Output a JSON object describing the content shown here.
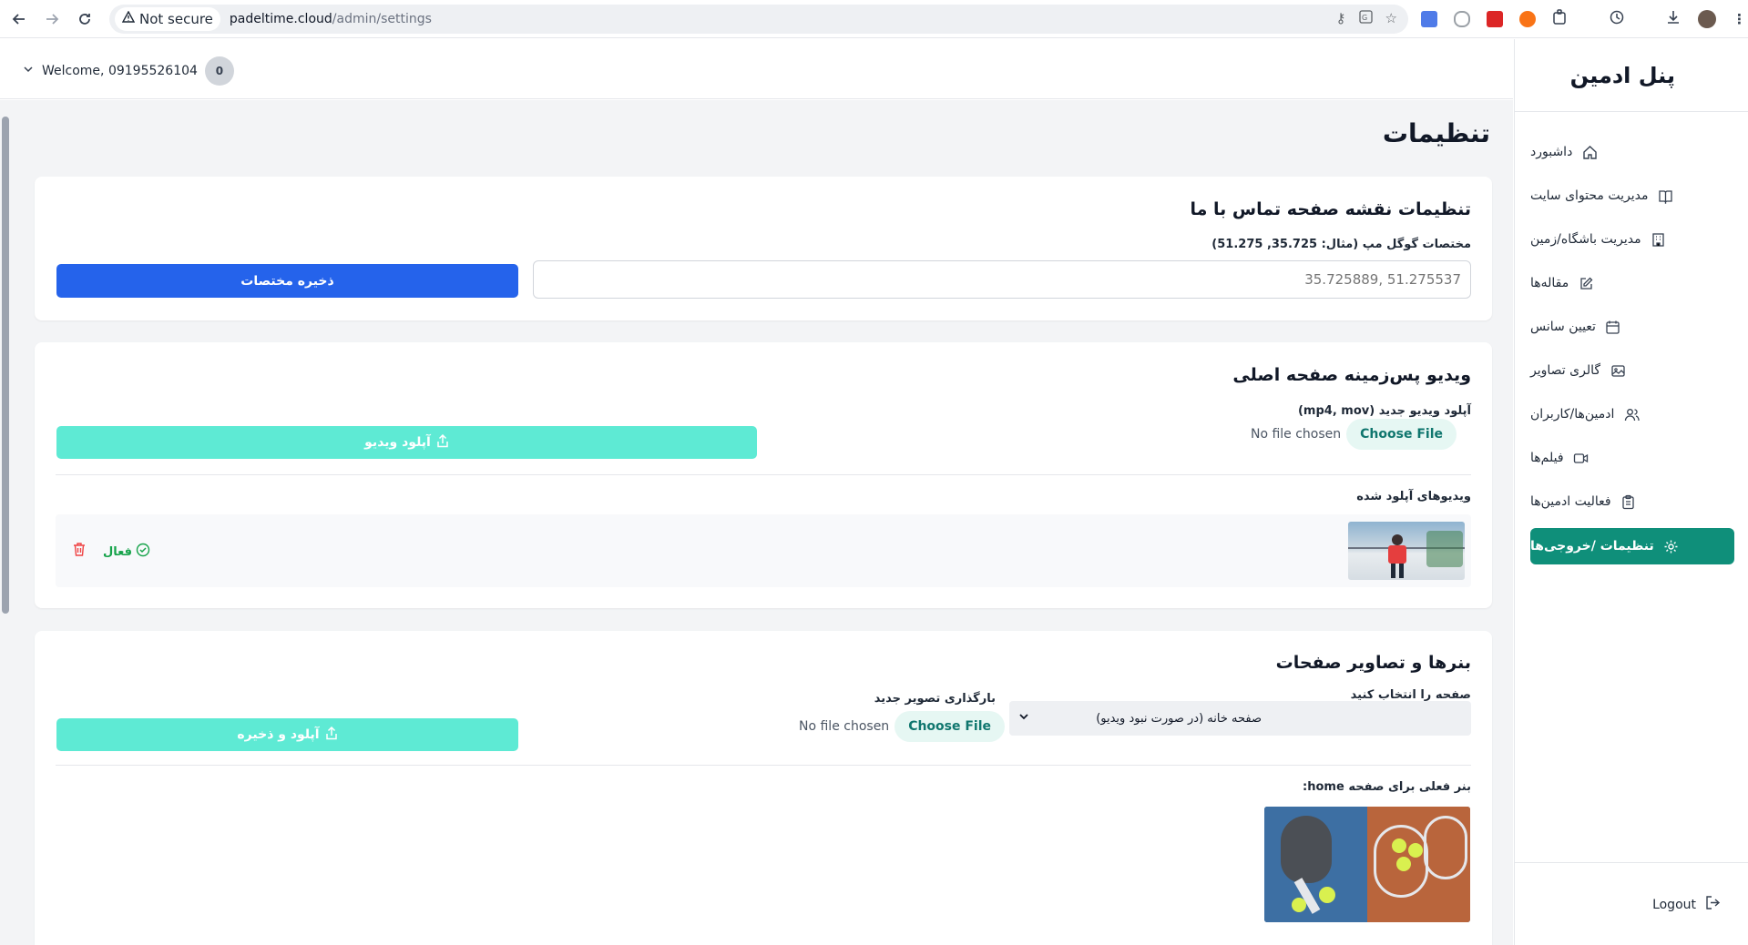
{
  "browser": {
    "security_label": "Not secure",
    "url_host": "padeltime.cloud",
    "url_path": "/admin/settings"
  },
  "topbar": {
    "welcome_text": "Welcome, 09195526104",
    "notification_count": "0"
  },
  "sidebar": {
    "title": "پنل ادمین",
    "items": [
      {
        "label": "داشبورد",
        "icon": "home-icon"
      },
      {
        "label": "مدیریت محتوای سایت",
        "icon": "book-icon"
      },
      {
        "label": "مدیریت باشگاه/زمین",
        "icon": "building-icon"
      },
      {
        "label": "مقاله‌ها",
        "icon": "edit-icon"
      },
      {
        "label": "تعیین سانس",
        "icon": "calendar-icon"
      },
      {
        "label": "گالری تصاویر",
        "icon": "image-icon"
      },
      {
        "label": "ادمین‌ها/کاربران",
        "icon": "users-icon"
      },
      {
        "label": "فیلم‌ها",
        "icon": "video-icon"
      },
      {
        "label": "فعالیت ادمین‌ها",
        "icon": "clipboard-icon"
      },
      {
        "label": "تنظیمات /خروجی‌ها",
        "icon": "gear-icon",
        "active": true
      }
    ],
    "logout_label": "Logout"
  },
  "page": {
    "title": "تنظیمات"
  },
  "map_settings": {
    "title": "تنظیمات نقشه صفحه تماس با ما",
    "coords_label": "مختصات گوگل مپ (مثال: 35.725, 51.275)",
    "coords_placeholder": "35.725889, 51.275537",
    "save_button": "ذخیره مختصات"
  },
  "video_settings": {
    "title": "ویدیو پس‌زمینه صفحه اصلی",
    "upload_label": "آپلود ویدیو جدید (mp4, mov)",
    "choose_file": "Choose File",
    "no_file": "No file chosen",
    "upload_button": "آپلود ویدیو",
    "uploaded_title": "ویدیوهای آپلود شده",
    "videos": [
      {
        "status": "فعال"
      }
    ]
  },
  "banner_settings": {
    "title": "بنرها و تصاویر صفحات",
    "page_select_label": "صفحه را انتخاب کنید",
    "page_select_value": "صفحه خانه (در صورت نبود ویدیو)",
    "new_image_label": "بارگذاری تصویر جدید",
    "choose_file": "Choose File",
    "no_file": "No file chosen",
    "upload_button": "آپلود و ذخیره",
    "current_banner_label": "بنر فعلی برای صفحه home:"
  },
  "colors": {
    "primary_blue": "#2563eb",
    "teal_button": "#5eead4",
    "sidebar_active": "#0f8f7a",
    "danger": "#ef4444",
    "success": "#16a34a"
  }
}
